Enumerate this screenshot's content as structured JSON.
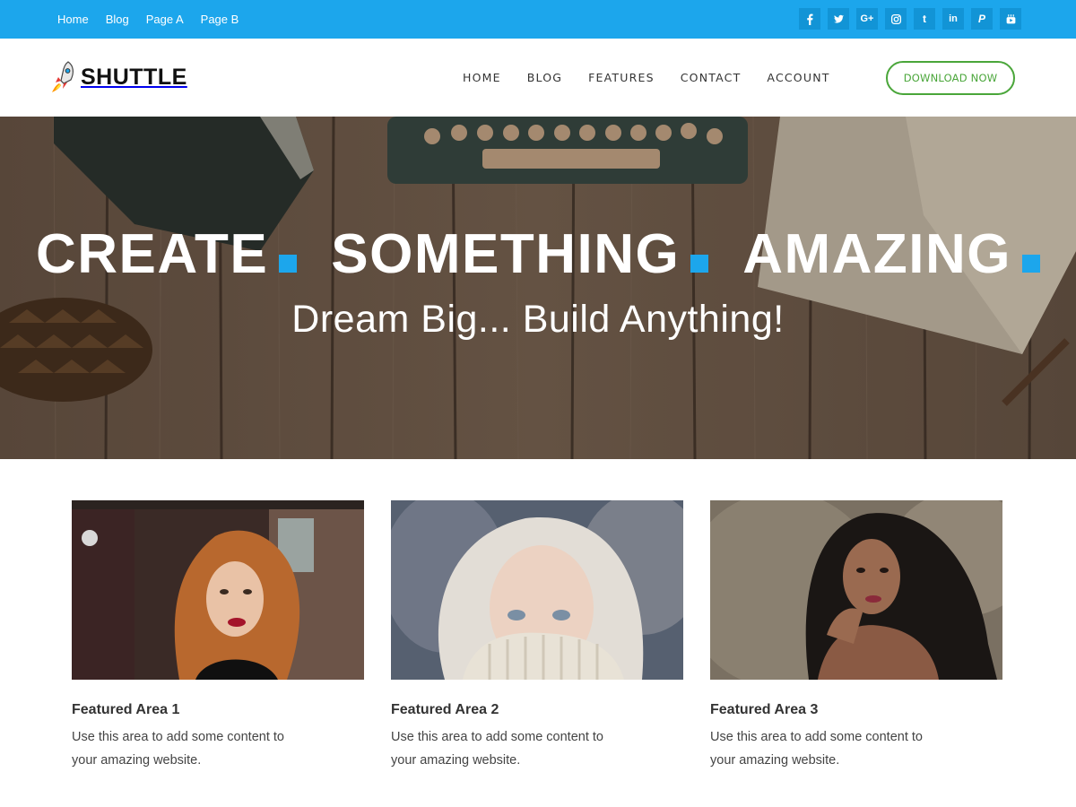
{
  "topbar": {
    "links": [
      "Home",
      "Blog",
      "Page A",
      "Page B"
    ],
    "socials": [
      {
        "icon": "facebook-icon",
        "glyph": "f"
      },
      {
        "icon": "twitter-icon",
        "glyph": "t"
      },
      {
        "icon": "google-plus-icon",
        "glyph": "G+"
      },
      {
        "icon": "instagram-icon",
        "glyph": "ig"
      },
      {
        "icon": "tumblr-icon",
        "glyph": "t"
      },
      {
        "icon": "linkedin-icon",
        "glyph": "in"
      },
      {
        "icon": "paypal-icon",
        "glyph": "P"
      },
      {
        "icon": "youtube-icon",
        "glyph": "yt"
      }
    ],
    "color": "#1ca6ec"
  },
  "header": {
    "logo_text": "SHUTTLE",
    "nav": [
      "HOME",
      "BLOG",
      "FEATURES",
      "CONTACT",
      "ACCOUNT"
    ],
    "cta_label": "DOWNLOAD NOW",
    "cta_color": "#4aa63a"
  },
  "hero": {
    "title_words": [
      "CREATE",
      "SOMETHING",
      "AMAZING"
    ],
    "subtitle": "Dream Big... Build Anything!",
    "accent": "#1ca6ec"
  },
  "features": [
    {
      "title": "Featured Area 1",
      "text": "Use this area to add some content to your amazing website."
    },
    {
      "title": "Featured Area 2",
      "text": "Use this area to add some content to your amazing website."
    },
    {
      "title": "Featured Area 3",
      "text": "Use this area to add some content to your amazing website."
    }
  ]
}
